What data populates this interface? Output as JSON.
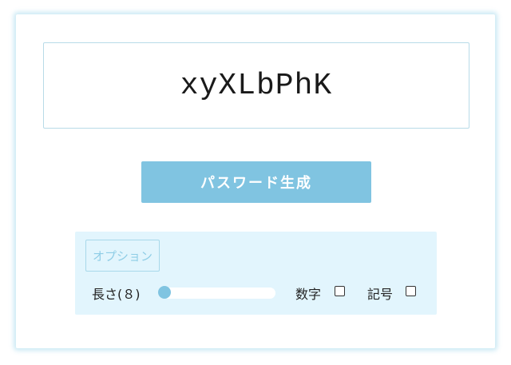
{
  "password": {
    "value": "xyXLbPhK"
  },
  "generate_button": {
    "label": "パスワード生成"
  },
  "options": {
    "title": "オプション",
    "length_label": "長さ(８)",
    "length_value": 8,
    "numbers_label": "数字",
    "numbers_checked": false,
    "symbols_label": "記号",
    "symbols_checked": false
  },
  "colors": {
    "accent": "#80c4e1",
    "panel_background": "#e2f5fd",
    "border": "#b8dbe8"
  }
}
